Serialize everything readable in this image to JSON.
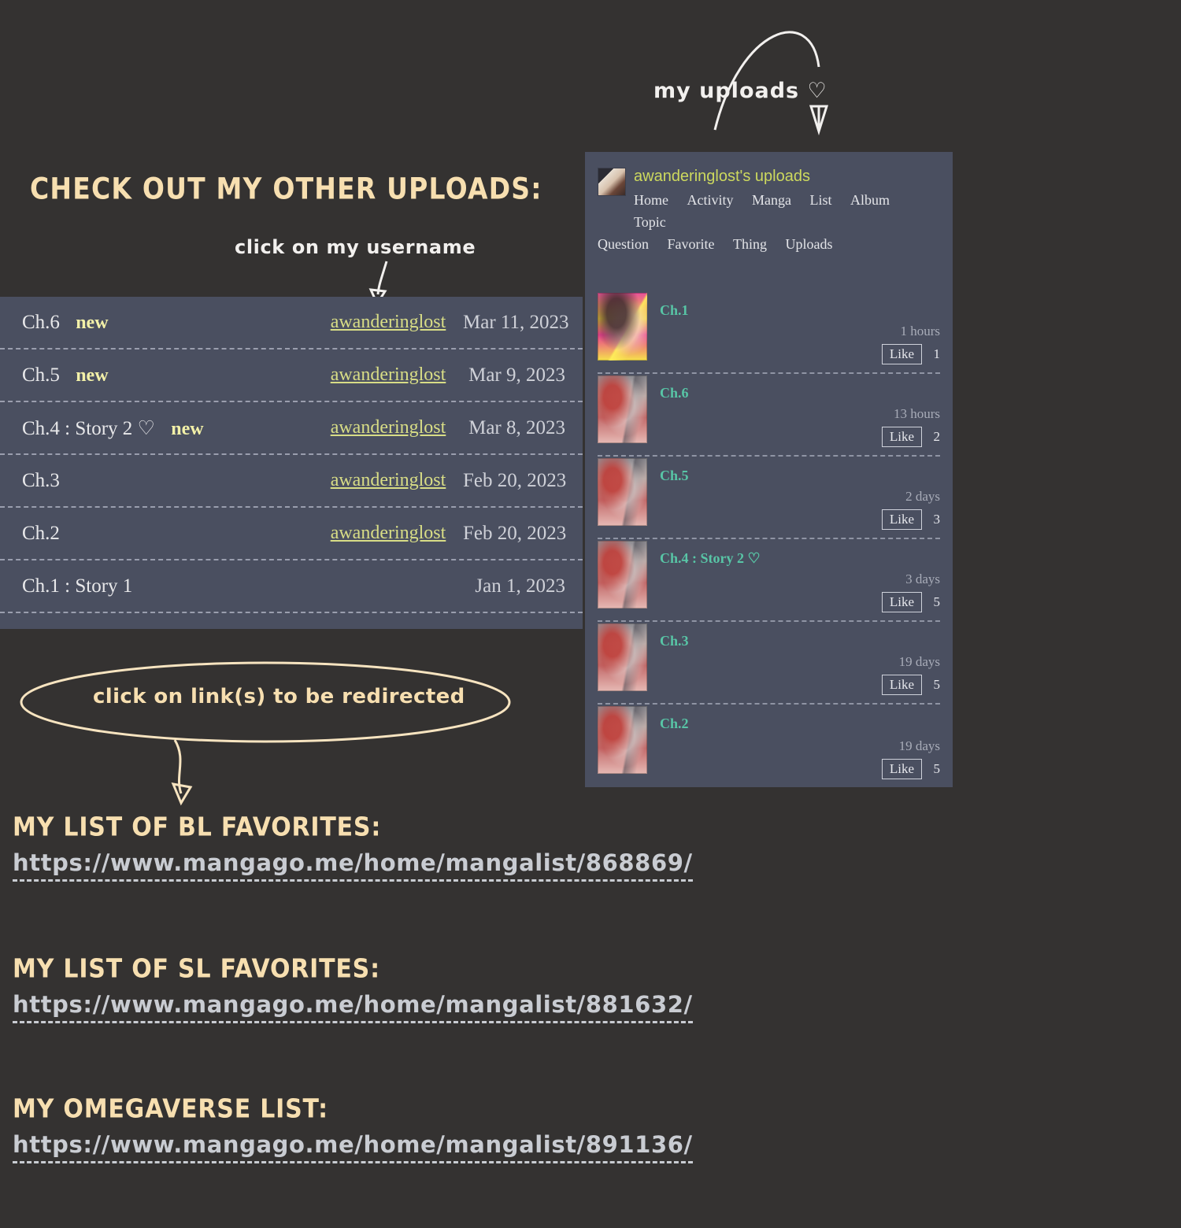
{
  "annotations": {
    "uploads_callout": "my uploads ♡",
    "check_heading": "CHECK OUT MY OTHER UPLOADS:",
    "username_callout": "click on my username",
    "redirect_callout": "click on link(s) to be redirected"
  },
  "chapter_table": {
    "rows": [
      {
        "title": "Ch.6",
        "new": "new",
        "user": "awanderinglost",
        "date": "Mar 11, 2023"
      },
      {
        "title": "Ch.5",
        "new": "new",
        "user": "awanderinglost",
        "date": "Mar 9, 2023"
      },
      {
        "title": "Ch.4 : Story 2 ♡",
        "new": "new",
        "user": "awanderinglost",
        "date": "Mar 8, 2023"
      },
      {
        "title": "Ch.3",
        "new": "",
        "user": "awanderinglost",
        "date": "Feb 20, 2023"
      },
      {
        "title": "Ch.2",
        "new": "",
        "user": "awanderinglost",
        "date": "Feb 20, 2023"
      },
      {
        "title": "Ch.1 : Story 1",
        "new": "",
        "user": "",
        "date": "Jan 1, 2023"
      }
    ]
  },
  "lists": [
    {
      "heading": "MY LIST OF BL FAVORITES:",
      "url": "https://www.mangago.me/home/mangalist/868869/"
    },
    {
      "heading": "MY LIST OF SL FAVORITES:",
      "url": "https://www.mangago.me/home/mangalist/881632/"
    },
    {
      "heading": "MY OMEGAVERSE LIST:",
      "url": "https://www.mangago.me/home/mangalist/891136/"
    }
  ],
  "uploads_widget": {
    "title": "awanderinglost's uploads",
    "nav_row1": [
      "Home",
      "Activity",
      "Manga",
      "List",
      "Album",
      "Topic"
    ],
    "nav_row2": [
      "Question",
      "Favorite",
      "Thing",
      "Uploads"
    ],
    "like_label": "Like",
    "items": [
      {
        "chapter": "Ch.1",
        "time": "1 hours",
        "likes": "1",
        "cover": "thumb-a"
      },
      {
        "chapter": "Ch.6",
        "time": "13 hours",
        "likes": "2",
        "cover": "thumb-b"
      },
      {
        "chapter": "Ch.5",
        "time": "2 days",
        "likes": "3",
        "cover": "thumb-b"
      },
      {
        "chapter": "Ch.4 : Story 2 ♡",
        "time": "3 days",
        "likes": "5",
        "cover": "thumb-b"
      },
      {
        "chapter": "Ch.3",
        "time": "19 days",
        "likes": "5",
        "cover": "thumb-b"
      },
      {
        "chapter": "Ch.2",
        "time": "19 days",
        "likes": "5",
        "cover": "thumb-b"
      }
    ]
  },
  "colors": {
    "page_bg": "#343231",
    "panel_bg": "#4a4f60",
    "cream": "#f7dfb0",
    "link_yellow": "#d8dd86",
    "teal": "#58c5a6",
    "title_yellow": "#cdd95e"
  }
}
